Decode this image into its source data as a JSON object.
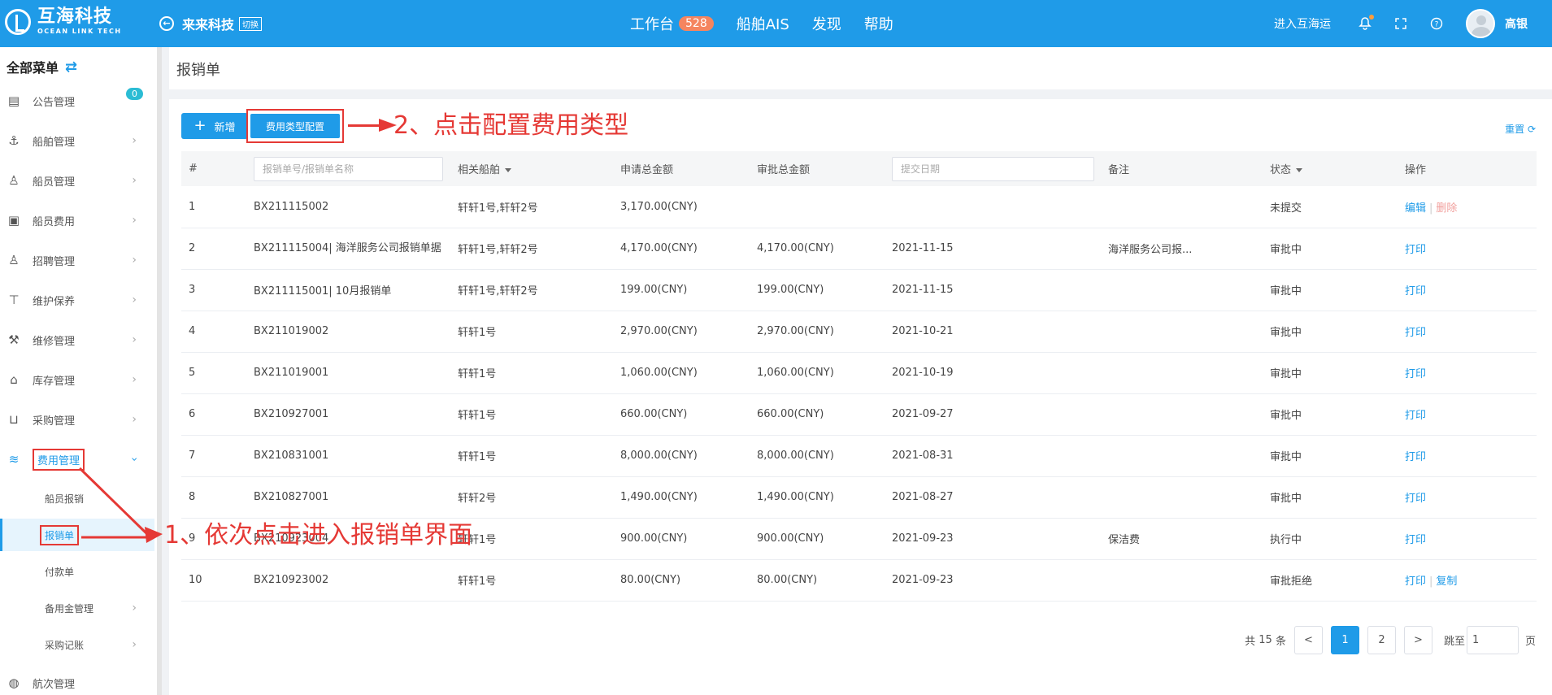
{
  "header": {
    "logo_cn": "互海科技",
    "logo_en": "OCEAN LINK TECH",
    "company": "来来科技",
    "company_switch": "切换",
    "nav": [
      {
        "label": "工作台",
        "badge": "528"
      },
      {
        "label": "船舶AIS"
      },
      {
        "label": "发现"
      },
      {
        "label": "帮助"
      }
    ],
    "enter_link": "进入互海运",
    "username": "高银",
    "accent": "#1f9be8"
  },
  "sidebar": {
    "title": "全部菜单",
    "items": [
      {
        "label": "公告管理",
        "icon": "book-icon",
        "count": "0"
      },
      {
        "label": "船舶管理",
        "icon": "anchor-icon"
      },
      {
        "label": "船员管理",
        "icon": "person-icon"
      },
      {
        "label": "船员费用",
        "icon": "wallet-icon"
      },
      {
        "label": "招聘管理",
        "icon": "recruit-icon"
      },
      {
        "label": "维护保养",
        "icon": "tool-icon"
      },
      {
        "label": "维修管理",
        "icon": "wrench-icon"
      },
      {
        "label": "库存管理",
        "icon": "house-icon"
      },
      {
        "label": "采购管理",
        "icon": "cart-icon"
      },
      {
        "label": "费用管理",
        "icon": "database-icon"
      }
    ],
    "sub_items": [
      {
        "label": "船员报销"
      },
      {
        "label": "报销单"
      },
      {
        "label": "付款单"
      },
      {
        "label": "备用金管理"
      },
      {
        "label": "采购记账"
      }
    ],
    "bottom_item": {
      "label": "航次管理",
      "icon": "globe-icon"
    }
  },
  "page": {
    "title": "报销单",
    "add_button": "新增",
    "config_button": "费用类型配置",
    "reset": "重置"
  },
  "annotations": {
    "step1": "1、依次点击进入报销单界面",
    "step2": "2、点击配置费用类型",
    "color": "#e53935"
  },
  "table": {
    "headers": {
      "index": "#",
      "search_placeholder": "报销单号/报销单名称",
      "ship": "相关船舶",
      "applied": "申请总金额",
      "approved": "审批总金额",
      "date_placeholder": "提交日期",
      "remark": "备注",
      "status": "状态",
      "ops": "操作"
    },
    "rows": [
      {
        "no": "1",
        "code": "BX211115002",
        "ship": "轩轩1号,轩轩2号",
        "applied": "3,170.00(CNY)",
        "approved": "",
        "date": "",
        "remark": "",
        "status": "未提交",
        "op1": "编辑",
        "op2": "删除"
      },
      {
        "no": "2",
        "code": "BX211115004| 海洋服务公司报销单据",
        "ship": "轩轩1号,轩轩2号",
        "applied": "4,170.00(CNY)",
        "approved": "4,170.00(CNY)",
        "date": "2021-11-15",
        "remark": "海洋服务公司报...",
        "status": "审批中",
        "op1": "打印",
        "op2": ""
      },
      {
        "no": "3",
        "code": "BX211115001| 10月报销单",
        "ship": "轩轩1号,轩轩2号",
        "applied": "199.00(CNY)",
        "approved": "199.00(CNY)",
        "date": "2021-11-15",
        "remark": "",
        "status": "审批中",
        "op1": "打印",
        "op2": ""
      },
      {
        "no": "4",
        "code": "BX211019002",
        "ship": "轩轩1号",
        "applied": "2,970.00(CNY)",
        "approved": "2,970.00(CNY)",
        "date": "2021-10-21",
        "remark": "",
        "status": "审批中",
        "op1": "打印",
        "op2": ""
      },
      {
        "no": "5",
        "code": "BX211019001",
        "ship": "轩轩1号",
        "applied": "1,060.00(CNY)",
        "approved": "1,060.00(CNY)",
        "date": "2021-10-19",
        "remark": "",
        "status": "审批中",
        "op1": "打印",
        "op2": ""
      },
      {
        "no": "6",
        "code": "BX210927001",
        "ship": "轩轩1号",
        "applied": "660.00(CNY)",
        "approved": "660.00(CNY)",
        "date": "2021-09-27",
        "remark": "",
        "status": "审批中",
        "op1": "打印",
        "op2": ""
      },
      {
        "no": "7",
        "code": "BX210831001",
        "ship": "轩轩1号",
        "applied": "8,000.00(CNY)",
        "approved": "8,000.00(CNY)",
        "date": "2021-08-31",
        "remark": "",
        "status": "审批中",
        "op1": "打印",
        "op2": ""
      },
      {
        "no": "8",
        "code": "BX210827001",
        "ship": "轩轩2号",
        "applied": "1,490.00(CNY)",
        "approved": "1,490.00(CNY)",
        "date": "2021-08-27",
        "remark": "",
        "status": "审批中",
        "op1": "打印",
        "op2": ""
      },
      {
        "no": "9",
        "code": "BX210923004",
        "ship": "轩轩1号",
        "applied": "900.00(CNY)",
        "approved": "900.00(CNY)",
        "date": "2021-09-23",
        "remark": "保洁费",
        "status": "执行中",
        "op1": "打印",
        "op2": ""
      },
      {
        "no": "10",
        "code": "BX210923002",
        "ship": "轩轩1号",
        "applied": "80.00(CNY)",
        "approved": "80.00(CNY)",
        "date": "2021-09-23",
        "remark": "",
        "status": "审批拒绝",
        "op1": "打印",
        "op2": "复制"
      }
    ]
  },
  "pagination": {
    "total_prefix": "共",
    "total": "15",
    "total_suffix": "条",
    "prev": "<",
    "pages": [
      "1",
      "2"
    ],
    "current": "1",
    "next": ">",
    "jump_label": "跳至",
    "jump_value": "1",
    "jump_suffix": "页"
  }
}
